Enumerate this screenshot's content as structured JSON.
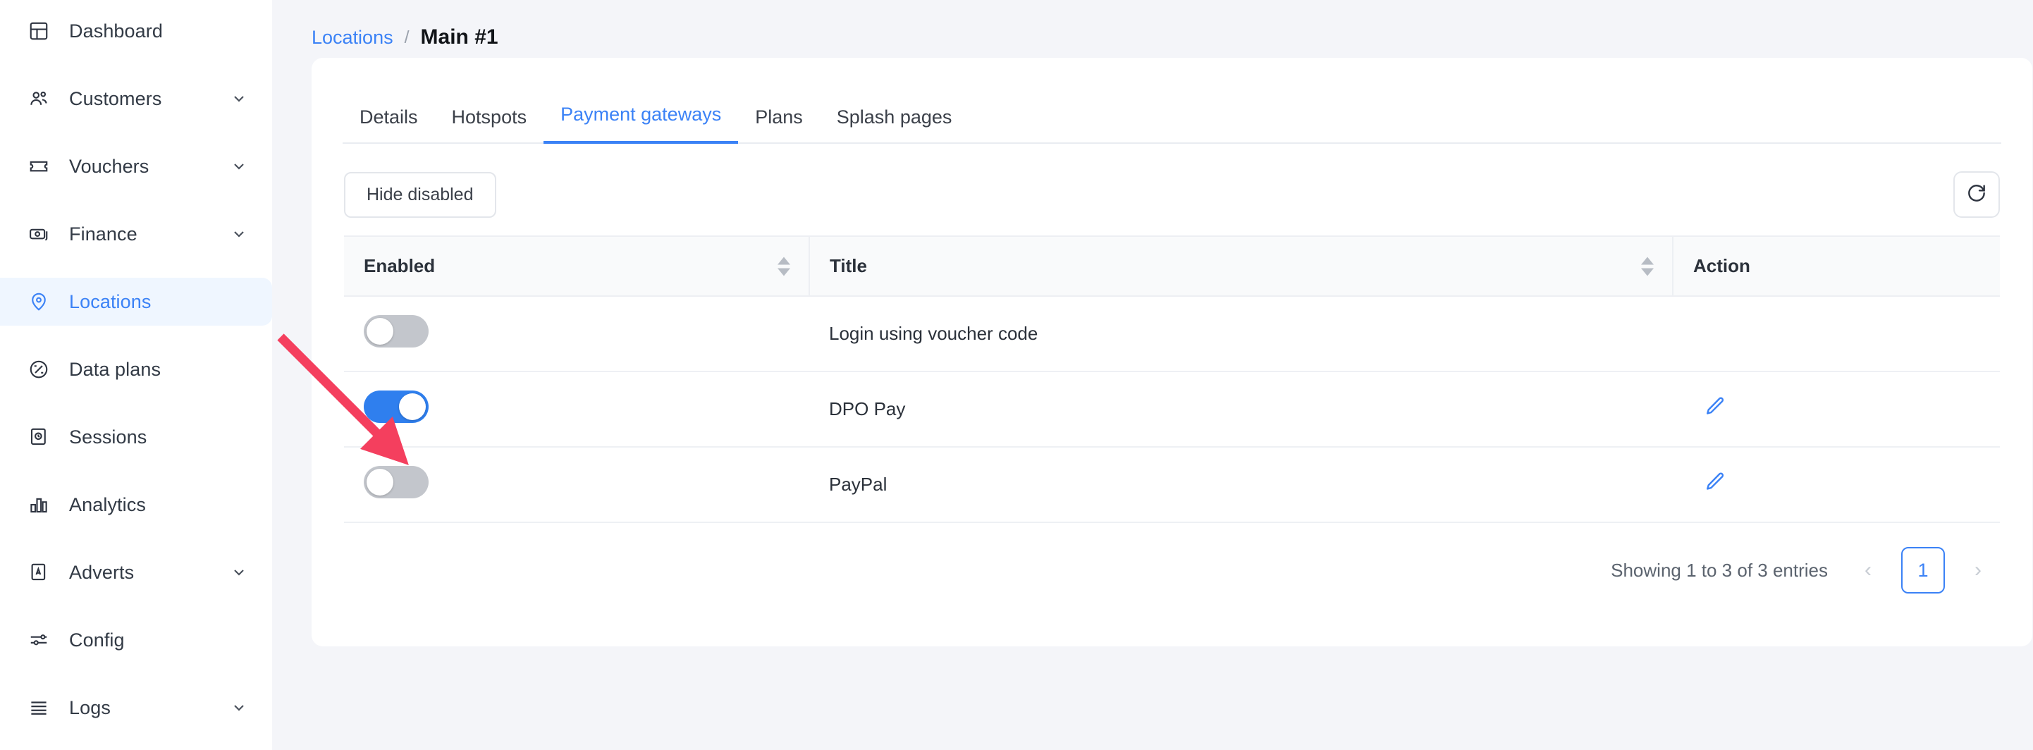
{
  "sidebar": {
    "items": [
      {
        "label": "Dashboard",
        "icon": "dashboard-icon",
        "expandable": false,
        "active": false
      },
      {
        "label": "Customers",
        "icon": "customers-icon",
        "expandable": true,
        "active": false
      },
      {
        "label": "Vouchers",
        "icon": "voucher-icon",
        "expandable": true,
        "active": false
      },
      {
        "label": "Finance",
        "icon": "money-icon",
        "expandable": true,
        "active": false
      },
      {
        "label": "Locations",
        "icon": "map-pin-icon",
        "expandable": false,
        "active": true
      },
      {
        "label": "Data plans",
        "icon": "data-plan-icon",
        "expandable": false,
        "active": false
      },
      {
        "label": "Sessions",
        "icon": "sessions-icon",
        "expandable": false,
        "active": false
      },
      {
        "label": "Analytics",
        "icon": "analytics-icon",
        "expandable": false,
        "active": false
      },
      {
        "label": "Adverts",
        "icon": "adverts-icon",
        "expandable": true,
        "active": false
      },
      {
        "label": "Config",
        "icon": "config-icon",
        "expandable": false,
        "active": false
      },
      {
        "label": "Logs",
        "icon": "logs-icon",
        "expandable": true,
        "active": false
      }
    ]
  },
  "breadcrumb": {
    "parent": "Locations",
    "separator": "/",
    "current": "Main #1"
  },
  "tabs": [
    {
      "label": "Details",
      "active": false
    },
    {
      "label": "Hotspots",
      "active": false
    },
    {
      "label": "Payment gateways",
      "active": true
    },
    {
      "label": "Plans",
      "active": false
    },
    {
      "label": "Splash pages",
      "active": false
    }
  ],
  "toolbar": {
    "hide_disabled_label": "Hide disabled",
    "refresh_icon": "refresh-icon"
  },
  "table": {
    "columns": [
      {
        "label": "Enabled",
        "sortable": true
      },
      {
        "label": "Title",
        "sortable": true
      },
      {
        "label": "Action",
        "sortable": false
      }
    ],
    "rows": [
      {
        "enabled": false,
        "title": "Login using voucher code",
        "has_edit": false
      },
      {
        "enabled": true,
        "title": "DPO Pay",
        "has_edit": true
      },
      {
        "enabled": false,
        "title": "PayPal",
        "has_edit": true
      }
    ]
  },
  "pagination": {
    "info": "Showing 1 to 3 of 3 entries",
    "prev": "‹",
    "next": "›",
    "pages": [
      "1"
    ],
    "current_page": "1"
  },
  "annotation": {
    "type": "arrow",
    "color": "#f43f5e",
    "points_to": "enabled-toggle-row-2"
  },
  "colors": {
    "accent": "#3b82f6",
    "toggle_on": "#2f7fee",
    "toggle_off": "#c3c6cc",
    "page_bg": "#f4f5f9",
    "card_bg": "#ffffff",
    "annotation_red": "#f43f5e"
  }
}
